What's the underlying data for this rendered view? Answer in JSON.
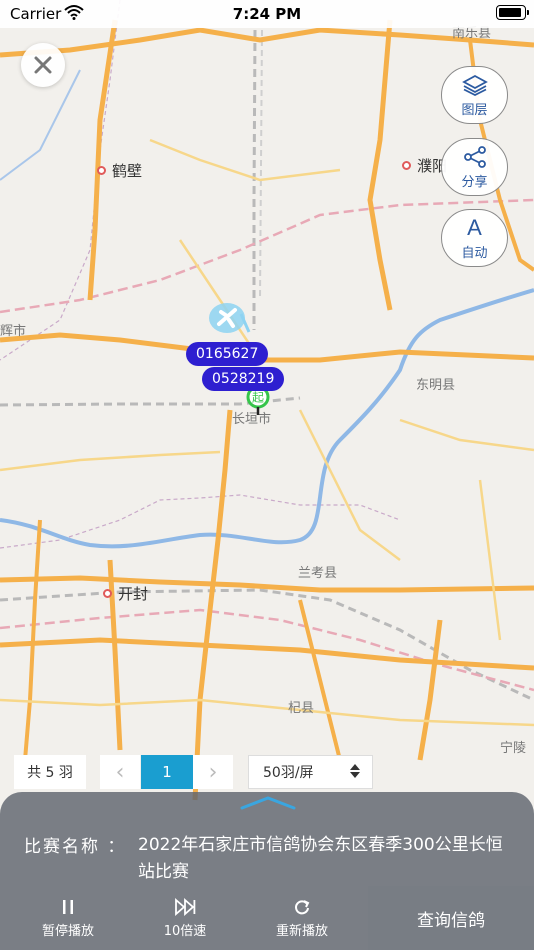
{
  "status_bar": {
    "carrier": "Carrier",
    "time": "7:24 PM"
  },
  "map": {
    "cities": [
      {
        "name": "鹤壁"
      },
      {
        "name": "濮阳"
      },
      {
        "name": "开封"
      }
    ],
    "counties": [
      {
        "name": "辉市"
      },
      {
        "name": "东明县"
      },
      {
        "name": "长垣市"
      },
      {
        "name": "兰考县"
      },
      {
        "name": "杞县"
      },
      {
        "name": "宁陵"
      },
      {
        "name": "南乐县"
      }
    ],
    "trackers": [
      {
        "id": "0165627"
      },
      {
        "id": "0528219"
      }
    ],
    "start_marker_text": "起"
  },
  "tools": {
    "layers": "图层",
    "share": "分享",
    "auto": "自动",
    "auto_letter": "A"
  },
  "pager": {
    "count": "共 5 羽",
    "prev": "‹",
    "current": "1",
    "next": "›",
    "page_size": "50羽/屏"
  },
  "panel": {
    "race_label": "比赛名称 ：",
    "race_name": "2022年石家庄市信鸽协会东区春季300公里长恒站比赛",
    "controls": {
      "pause": "暂停播放",
      "speed": "10倍速",
      "replay": "重新播放"
    },
    "query": "查询信鸽"
  },
  "colors": {
    "accent": "#1a9ed0",
    "tracker": "#2e1fd0",
    "road_major": "#f5b04a",
    "river": "#8fb8e6"
  }
}
